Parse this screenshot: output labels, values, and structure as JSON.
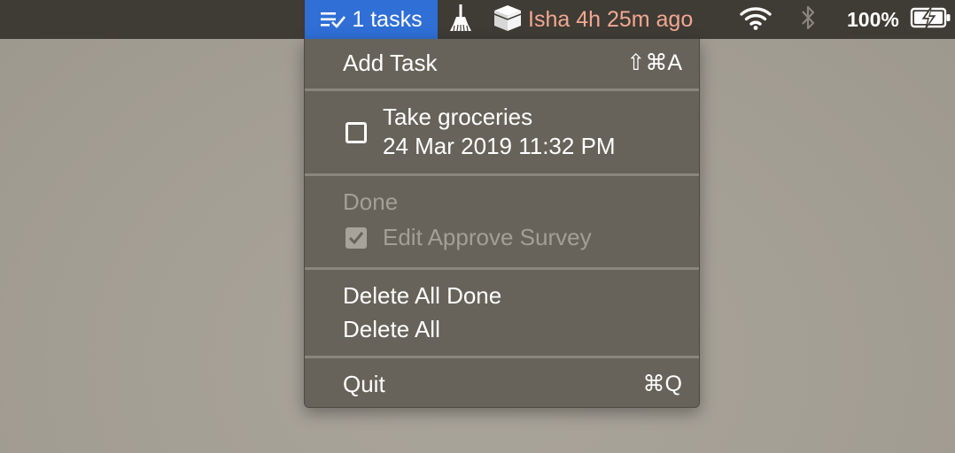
{
  "menubar": {
    "tasks_label": "1 tasks",
    "prayer_text": "Isha 4h 25m ago",
    "battery_percent": "100%",
    "icons": {
      "tasks": "task-list-icon",
      "broom": "broom-icon",
      "kaaba": "kaaba-icon",
      "wifi": "wifi-icon",
      "bluetooth": "bluetooth-icon",
      "battery": "battery-charging-icon"
    },
    "colors": {
      "tasks_highlight": "#2f6fd6",
      "prayer_text": "#f1a891",
      "bar": "#3f3b35"
    }
  },
  "menu": {
    "add_task": {
      "label": "Add Task",
      "shortcut": "⇧⌘A"
    },
    "pending_tasks": [
      {
        "title": "Take groceries",
        "date": "24 Mar 2019 11:32 PM",
        "checked": false
      }
    ],
    "done_header": "Done",
    "done_tasks": [
      {
        "title": "Edit Approve Survey",
        "checked": true
      }
    ],
    "delete_all_done": "Delete All Done",
    "delete_all": "Delete All",
    "quit": {
      "label": "Quit",
      "shortcut": "⌘Q"
    },
    "colors": {
      "background": "#67635a",
      "disabled_text": "#a39f96",
      "separator": "#8a867d"
    }
  }
}
